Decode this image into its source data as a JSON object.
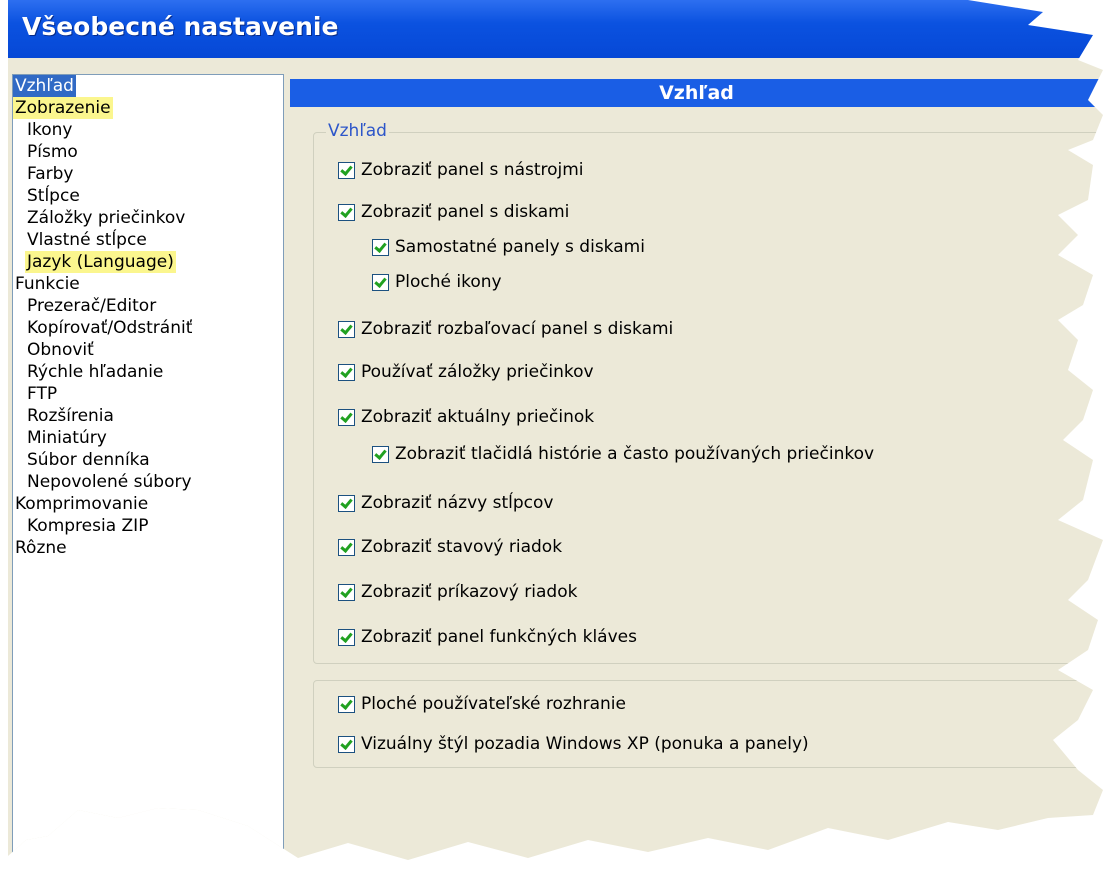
{
  "window": {
    "title": "Všeobecné nastavenie"
  },
  "tree": {
    "items": [
      {
        "label": "Vzhľad",
        "level": 0,
        "selected": true
      },
      {
        "label": "Zobrazenie",
        "level": 0,
        "highlighted": true
      },
      {
        "label": "Ikony",
        "level": 1
      },
      {
        "label": "Písmo",
        "level": 1
      },
      {
        "label": "Farby",
        "level": 1
      },
      {
        "label": "Stĺpce",
        "level": 1
      },
      {
        "label": "Záložky priečinkov",
        "level": 1
      },
      {
        "label": "Vlastné stĺpce",
        "level": 1
      },
      {
        "label": "Jazyk (Language)",
        "level": 1,
        "highlighted": true
      },
      {
        "label": "Funkcie",
        "level": 0
      },
      {
        "label": "Prezerač/Editor",
        "level": 1
      },
      {
        "label": "Kopírovať/Odstrániť",
        "level": 1
      },
      {
        "label": "Obnoviť",
        "level": 1
      },
      {
        "label": "Rýchle hľadanie",
        "level": 1
      },
      {
        "label": "FTP",
        "level": 1
      },
      {
        "label": "Rozšírenia",
        "level": 1
      },
      {
        "label": "Miniatúry",
        "level": 1
      },
      {
        "label": "Súbor denníka",
        "level": 1
      },
      {
        "label": "Nepovolené súbory",
        "level": 1
      },
      {
        "label": "Komprimovanie",
        "level": 0
      },
      {
        "label": "Kompresia ZIP",
        "level": 1
      },
      {
        "label": "Rôzne",
        "level": 0
      }
    ]
  },
  "page": {
    "header": "Vzhľad",
    "group1_label": "Vzhľad",
    "options": [
      {
        "label": "Zobraziť panel s nástrojmi",
        "checked": true
      },
      {
        "label": "Zobraziť panel s diskami",
        "checked": true
      },
      {
        "label": "Samostatné panely s diskami",
        "checked": true
      },
      {
        "label": "Ploché ikony",
        "checked": true
      },
      {
        "label": "Zobraziť rozbaľovací panel s diskami",
        "checked": true
      },
      {
        "label": "Používať záložky priečinkov",
        "checked": true
      },
      {
        "label": "Zobraziť aktuálny priečinok",
        "checked": true
      },
      {
        "label": "Zobraziť tlačidlá histórie a často používaných priečinkov",
        "checked": true
      },
      {
        "label": "Zobraziť názvy stĺpcov",
        "checked": true
      },
      {
        "label": "Zobraziť stavový riadok",
        "checked": true
      },
      {
        "label": "Zobraziť príkazový riadok",
        "checked": true
      },
      {
        "label": "Zobraziť panel funkčných kláves",
        "checked": true
      }
    ],
    "options2": [
      {
        "label": "Ploché používateľské rozhranie",
        "checked": true
      },
      {
        "label": "Vizuálny štýl pozadia Windows XP (ponuka a panely)",
        "checked": true
      }
    ]
  },
  "colors": {
    "titlebar": "#0648d6",
    "selection": "#316ac5",
    "highlight": "#fbf68e",
    "dialog_bg": "#ece9d8",
    "check": "#21a121"
  }
}
